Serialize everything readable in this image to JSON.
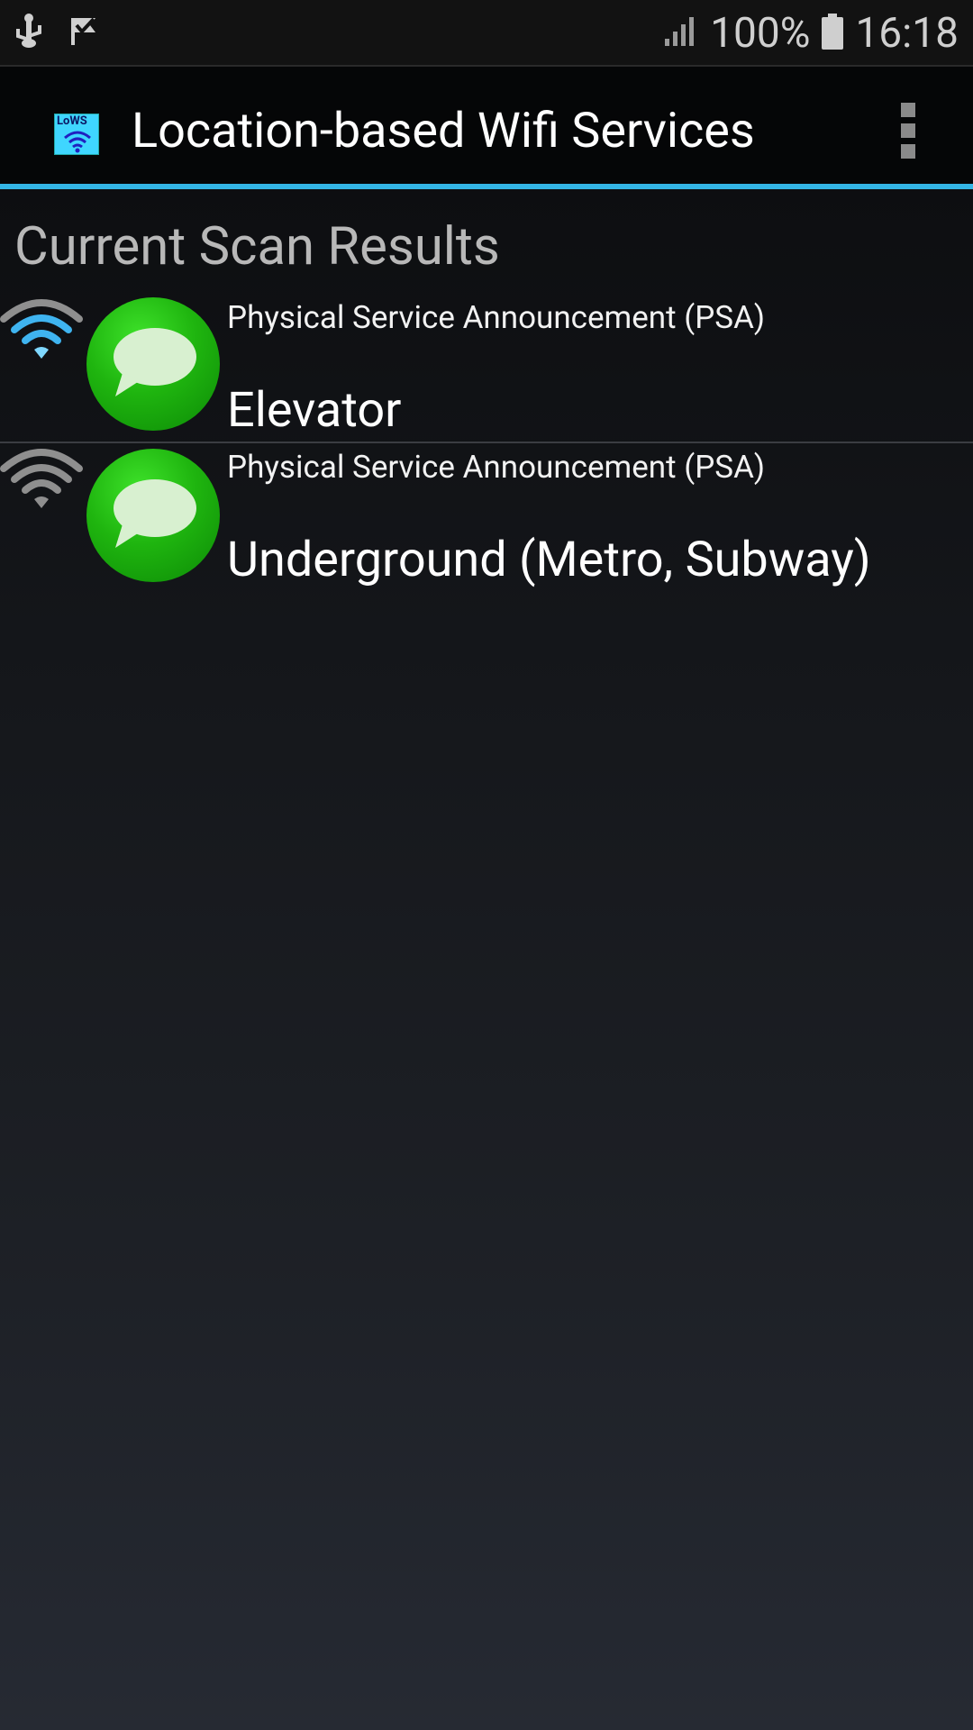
{
  "status_bar": {
    "battery_percent": "100%",
    "time": "16:18",
    "icons": [
      "usb-icon",
      "check-flag-icon",
      "signal-icon",
      "battery-icon"
    ]
  },
  "app_bar": {
    "title": "Location-based Wifi Services",
    "logo_text": "LoWS",
    "accent_color": "#33b5e5"
  },
  "main": {
    "section_title": "Current Scan Results",
    "items": [
      {
        "subtitle": "Physical Service Announcement (PSA)",
        "title": "Elevator",
        "wifi_state": "active",
        "icon": "message-bubble-icon"
      },
      {
        "subtitle": "Physical Service Announcement (PSA)",
        "title": "Underground (Metro, Subway)",
        "wifi_state": "inactive",
        "icon": "message-bubble-icon"
      }
    ]
  }
}
